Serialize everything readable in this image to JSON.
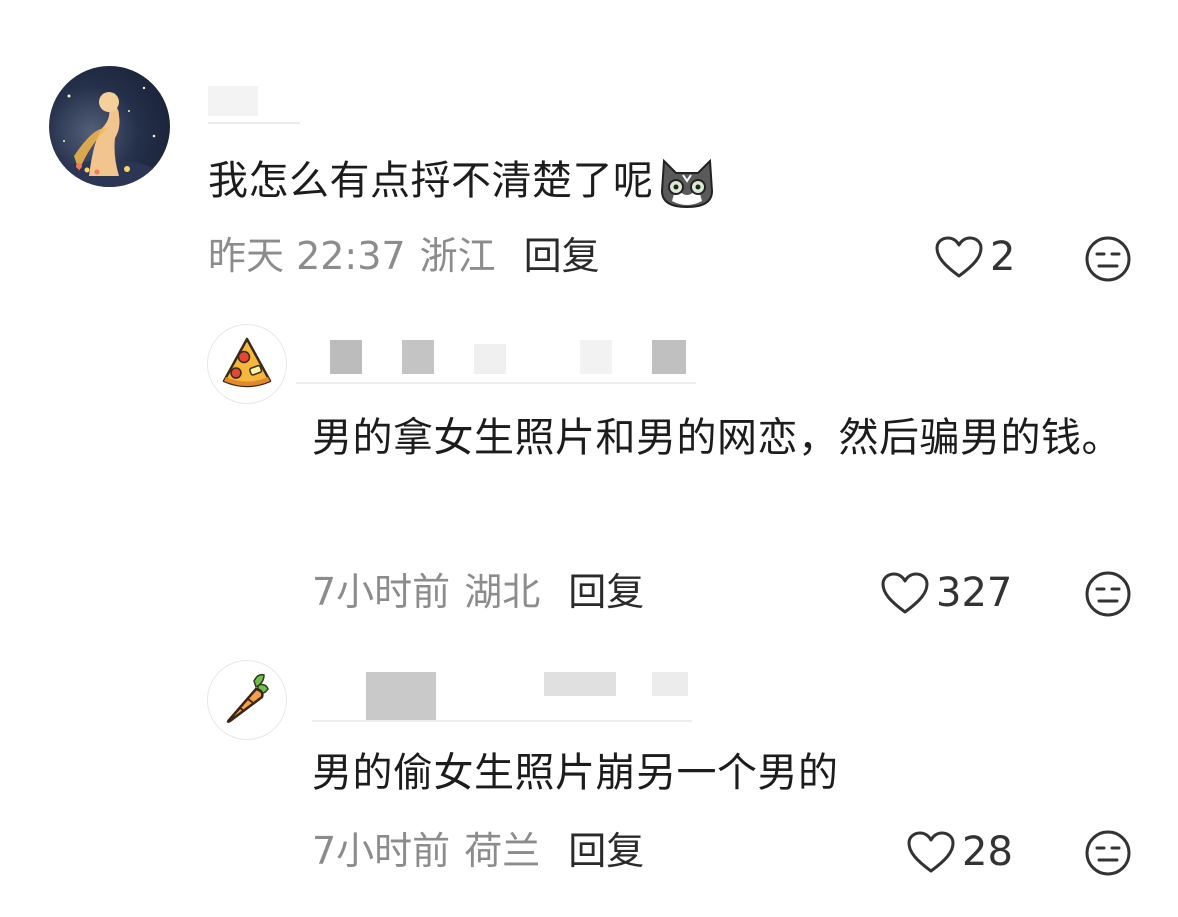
{
  "comments": [
    {
      "text": "我怎么有点捋不清楚了呢",
      "emoji": "cat-emoji",
      "time": "昨天 22:37",
      "region": "浙江",
      "reply_label": "回复",
      "likes": "2",
      "avatar": "starry-night-avatar"
    },
    {
      "text": "男的拿女生照片和男的网恋，然后骗男的钱。",
      "time": "7小时前",
      "region": "湖北",
      "reply_label": "回复",
      "likes": "327",
      "avatar": "pizza-avatar"
    },
    {
      "text": "男的偷女生照片崩另一个男的",
      "time": "7小时前",
      "region": "荷兰",
      "reply_label": "回复",
      "likes": "28",
      "avatar": "carrot-avatar"
    }
  ],
  "icons": {
    "like": "heart-outline-icon",
    "dislike": "meh-face-icon"
  },
  "colors": {
    "text": "#1c1c1c",
    "meta": "#8c8c8c",
    "icon": "#333333"
  }
}
